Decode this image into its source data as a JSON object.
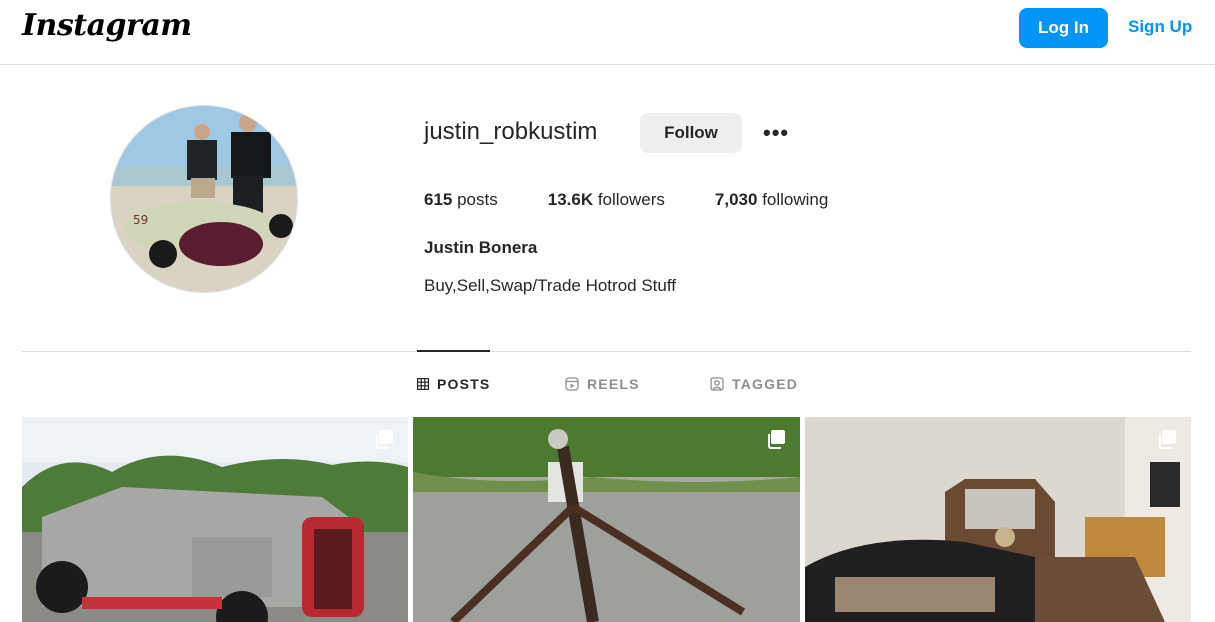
{
  "header": {
    "logo": "Instagram",
    "login_label": "Log In",
    "signup_label": "Sign Up"
  },
  "profile": {
    "username": "justin_robkustim",
    "follow_label": "Follow",
    "more_label": "•••",
    "stats": [
      {
        "num": "615",
        "label": " posts"
      },
      {
        "num": "13.6K",
        "label": " followers"
      },
      {
        "num": "7,030",
        "label": " following"
      }
    ],
    "full_name": "Justin Bonera",
    "bio": "Buy,Sell,Swap/Trade Hotrod Stuff"
  },
  "tabs": [
    {
      "label": "POSTS",
      "icon": "grid-icon",
      "active": true
    },
    {
      "label": "REELS",
      "icon": "reels-icon",
      "active": false
    },
    {
      "label": "TAGGED",
      "icon": "tagged-icon",
      "active": false
    }
  ],
  "posts": [
    {
      "icon": "multiple-posts-icon"
    },
    {
      "icon": "multiple-posts-icon"
    },
    {
      "icon": "multiple-posts-icon"
    }
  ],
  "colors": {
    "accent": "#0095f6",
    "border": "#dbdbdb",
    "muted": "#8e8e8e",
    "text": "#262626"
  }
}
